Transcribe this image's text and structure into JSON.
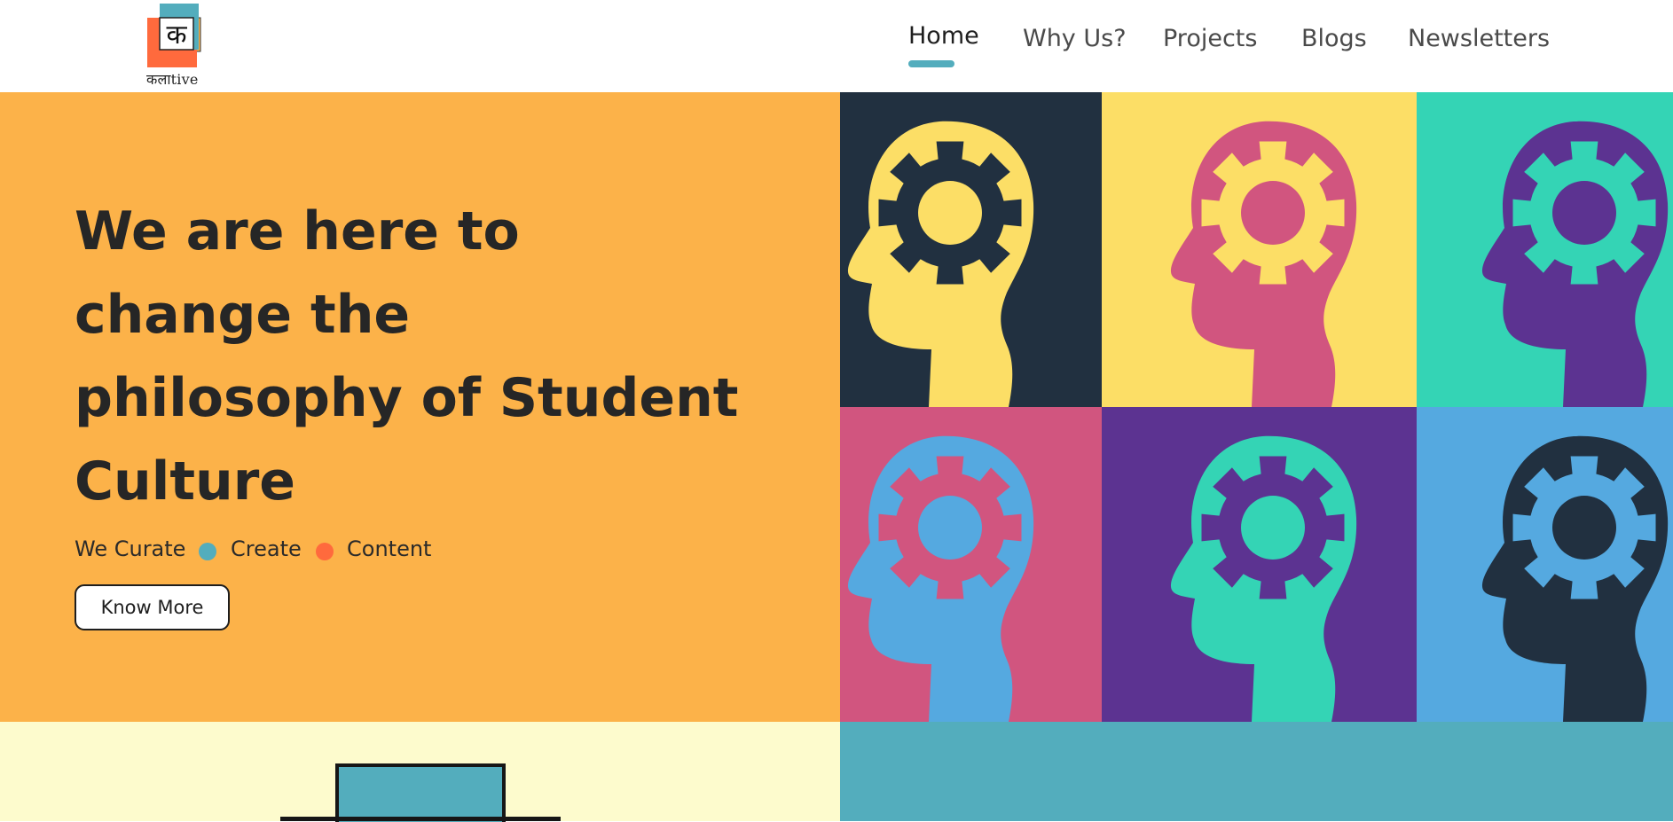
{
  "header": {
    "logo": {
      "glyph": "क",
      "wordmark": "कलाtive",
      "colors": {
        "teal": "#53adbd",
        "orange": "#ff6a3d",
        "yellow": "#fcb249"
      }
    },
    "nav": [
      {
        "label": "Home",
        "active": true
      },
      {
        "label": "Why Us?",
        "active": false
      },
      {
        "label": "Projects",
        "active": false
      },
      {
        "label": "Blogs",
        "active": false
      },
      {
        "label": "Newsletters",
        "active": false
      }
    ]
  },
  "hero": {
    "headline_lines": [
      "We are here to",
      "change the",
      "philosophy of Student",
      "Culture"
    ],
    "tagline": {
      "parts": [
        "We Curate",
        "Create",
        "Content"
      ],
      "dot_colors": [
        "#53adbd",
        "#ff6a3d"
      ]
    },
    "cta_label": "Know More",
    "background": "#fcb249"
  },
  "grid": {
    "icon": "head-gear-icon",
    "tiles": [
      {
        "bg": "#213040",
        "head": "#fcde66",
        "gear": "#213040",
        "hub": "#fcde66"
      },
      {
        "bg": "#fcde66",
        "head": "#d1557f",
        "gear": "#fcde66",
        "hub": "#d1557f"
      },
      {
        "bg": "#34d4b5",
        "head": "#5c3391",
        "gear": "#34d4b5",
        "hub": "#5c3391"
      },
      {
        "bg": "#d1557f",
        "head": "#55a9e0",
        "gear": "#d1557f",
        "hub": "#55a9e0"
      },
      {
        "bg": "#5c3391",
        "head": "#34d4b5",
        "gear": "#5c3391",
        "hub": "#34d4b5"
      },
      {
        "bg": "#55a9e0",
        "head": "#213040",
        "gear": "#55a9e0",
        "hub": "#213040"
      }
    ]
  },
  "bottom": {
    "left_bg": "#fdfbcd",
    "right_bg": "#53adbd",
    "illustration": "laptop-icon"
  }
}
